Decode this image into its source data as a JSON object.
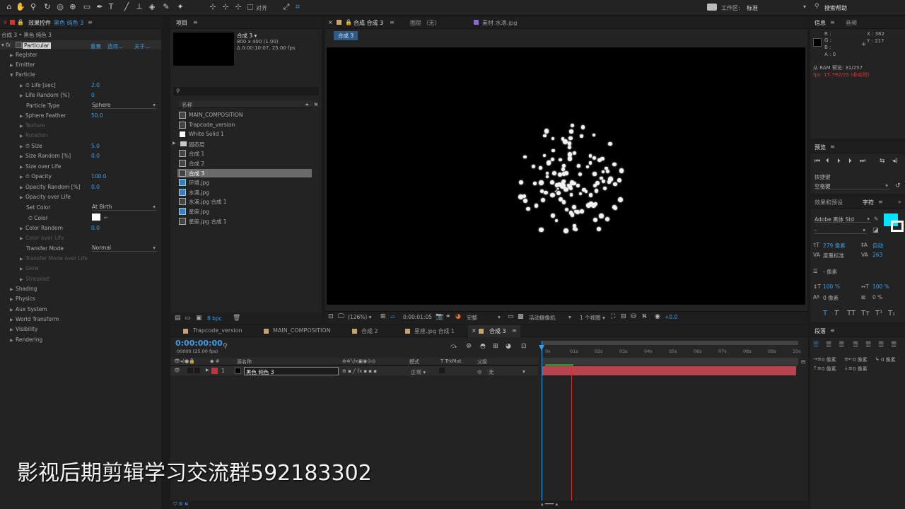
{
  "toolbar": {
    "align_label": "对齐",
    "workspace_label": "工作区:",
    "workspace_value": "标准",
    "search_help": "搜索帮助"
  },
  "effects": {
    "tab_label": "效果控件",
    "tab_target": "黑色 纯色 3",
    "breadcrumb": "合成 3 • 黑色 纯色 3",
    "effect_name": "Particular",
    "reset": "重置",
    "options": "选项...",
    "about": "关于...",
    "groups": {
      "register": "Register",
      "emitter": "Emitter",
      "particle": "Particle",
      "shading": "Shading",
      "physics": "Physics",
      "aux": "Aux System",
      "world": "World Transform",
      "visibility": "Visibility",
      "rendering": "Rendering"
    },
    "props": {
      "life": "Life [sec]",
      "life_v": "2.0",
      "liferand": "Life Random [%]",
      "liferand_v": "0",
      "ptype": "Particle Type",
      "ptype_v": "Sphere",
      "feather": "Sphere Feather",
      "feather_v": "50.0",
      "texture": "Texture",
      "rotation": "Rotation",
      "size": "Size",
      "size_v": "5.0",
      "sizerand": "Size Random [%]",
      "sizerand_v": "0.0",
      "sizeol": "Size over Life",
      "opacity": "Opacity",
      "opacity_v": "100.0",
      "oprand": "Opacity Random [%]",
      "oprand_v": "0.0",
      "opol": "Opacity over Life",
      "setcolor": "Set Color",
      "setcolor_v": "At Birth",
      "color": "Color",
      "colorrand": "Color Random",
      "colorrand_v": "0.0",
      "colorol": "Color over Life",
      "transfer": "Transfer Mode",
      "transfer_v": "Normal",
      "transferol": "Transfer Mode over Life",
      "glow": "Glow",
      "streaklet": "Streaklet"
    }
  },
  "project": {
    "tab_label": "项目",
    "comp_name": "合成 3 ▾",
    "comp_dims": "800 x 400 (1.00)",
    "comp_dur": "Δ 0:00:10:07, 25.00 fps",
    "name_header": "名称",
    "bpc": "8 bpc",
    "items": [
      "MAIN_COMPOSITION",
      "Trapcode_version",
      "White Solid 1",
      "固态层",
      "合成 1",
      "合成 2",
      "合成 3",
      "环境.jpg",
      "水滴.jpg",
      "水滴.jpg 合成 1",
      "星座.jpg",
      "星座.jpg 合成 1"
    ]
  },
  "viewer": {
    "tabs": [
      "合成 合成 3",
      "图层 （无）",
      "素材 水滴.jpg"
    ],
    "subtab": "合成 3",
    "zoom": "(126%)",
    "timecode": "0:00:01:05",
    "quality": "完整",
    "camera": "活动摄像机",
    "views": "1 个视图",
    "exposure": "+0.0"
  },
  "info": {
    "tab_info": "信息",
    "tab_audio": "音频",
    "r": "R :",
    "g": "G :",
    "b": "B :",
    "a": "A : 0",
    "x": "X : 382",
    "y": "Y : 217",
    "ram": "从 RAM 预览: 31/257",
    "fps": "fps: 15.792/25 (非实时)"
  },
  "preview": {
    "tab": "预览",
    "shortcut_label": "快捷键",
    "shortcut_value": "空格键"
  },
  "character": {
    "tab_effects": "效果和预设",
    "tab_char": "字符",
    "font": "Adobe 黑体 Std",
    "style": "-",
    "size": "279 像素",
    "leading": "自动",
    "tracking_label": "度量标准",
    "tracking": "263",
    "stroke": "- 像素",
    "vscale": "100 %",
    "hscale": "100 %",
    "baseline": "0 像素",
    "tsume": "0 %",
    "fill_color": "#00e5ff"
  },
  "paragraph": {
    "tab": "段落",
    "indent1": "0 像素",
    "indent2": "0 像素",
    "indent3": "0 像素",
    "space1": "0 像素",
    "space2": "0 像素"
  },
  "timeline": {
    "tabs": [
      "Trapcode_version",
      "MAIN_COMPOSITION",
      "合成 2",
      "星座.jpg 合成 1",
      "合成 3"
    ],
    "timecode": "0:00:00:00",
    "frames": "00000 (25.00 fps)",
    "col_layer": "源名称",
    "col_mode": "模式",
    "col_trkmat": "T  TrkMat",
    "col_parent": "父级",
    "layer_num": "1",
    "layer_name": "黑色 纯色 3",
    "layer_mode": "正常",
    "layer_parent": "无",
    "ruler": [
      "0s",
      "01s",
      "02s",
      "03s",
      "04s",
      "05s",
      "06s",
      "07s",
      "08s",
      "09s",
      "10s"
    ]
  },
  "watermark": "影视后期剪辑学习交流群592183302",
  "colors": {
    "accent": "#3b9de8",
    "layer_red": "#b8434f",
    "selection": "#6a6a6a"
  }
}
